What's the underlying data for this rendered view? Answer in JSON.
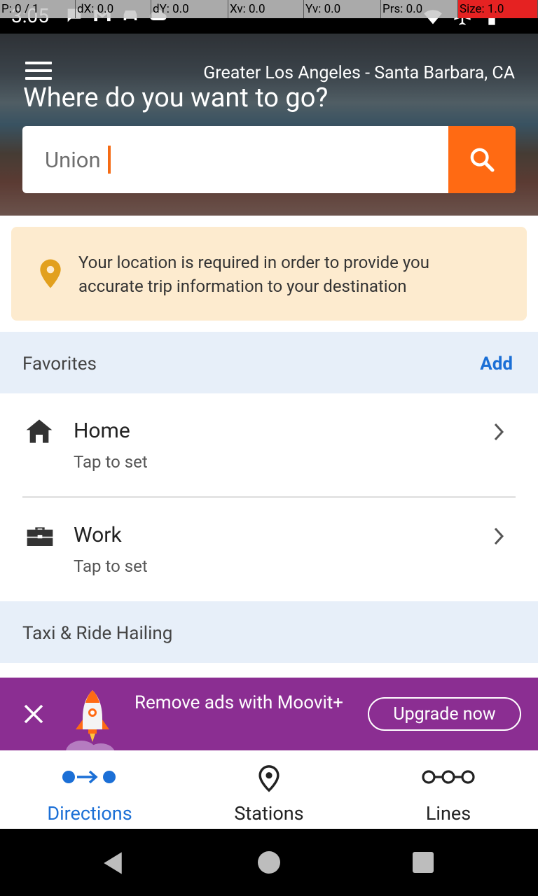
{
  "status_bar": {
    "time": "3:05",
    "overlay": [
      "P: 0 / 1",
      "dX: 0.0",
      "dY: 0.0",
      "Xv: 0.0",
      "Yv: 0.0",
      "Prs: 0.0",
      "Size: 1.0"
    ],
    "icons_left": [
      "messaging-icon",
      "gmail-icon",
      "car-icon",
      "cloud-icon"
    ],
    "icons_right": [
      "wifi-icon",
      "airplane-icon",
      "battery-icon"
    ]
  },
  "header": {
    "region": "Greater Los Angeles - Santa Barbara, CA",
    "title": "Where do you want to go?",
    "search_value": "Union",
    "search_icon": "search-icon"
  },
  "notice": {
    "icon": "location-pin-icon",
    "text": "Your location is required in order to provide you accurate trip information to your destination"
  },
  "favorites": {
    "title": "Favorites",
    "add_label": "Add",
    "items": [
      {
        "icon": "home-icon",
        "title": "Home",
        "subtitle": "Tap to set"
      },
      {
        "icon": "briefcase-icon",
        "title": "Work",
        "subtitle": "Tap to set"
      }
    ]
  },
  "taxi": {
    "title": "Taxi & Ride Hailing"
  },
  "ad": {
    "text": "Remove ads with Moovit+",
    "button": "Upgrade now",
    "color": "#8b2e92"
  },
  "bottom_nav": {
    "tabs": [
      {
        "label": "Directions",
        "icon": "directions-icon",
        "active": true
      },
      {
        "label": "Stations",
        "icon": "station-pin-icon",
        "active": false
      },
      {
        "label": "Lines",
        "icon": "lines-icon",
        "active": false
      }
    ]
  },
  "colors": {
    "accent_orange": "#ff6a13",
    "link_blue": "#1b6fd6",
    "notice_bg": "#fdebcf",
    "section_bg": "#e7eff9"
  }
}
